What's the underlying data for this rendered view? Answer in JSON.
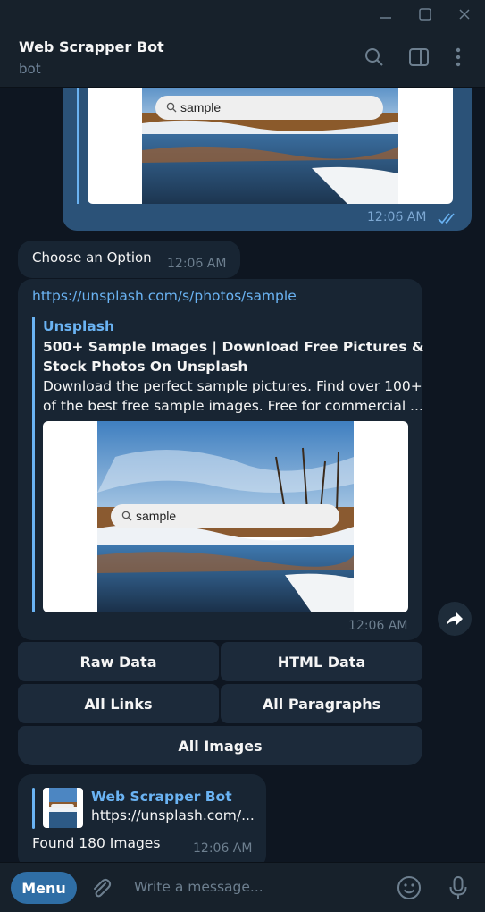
{
  "header": {
    "title": "Web Scrapper Bot",
    "subtitle": "bot"
  },
  "outgoing": {
    "search_text": "sample",
    "time": "12:06 AM"
  },
  "choose": {
    "text": "Choose an Option",
    "time": "12:06 AM"
  },
  "link_message": {
    "url": "https://unsplash.com/s/photos/sample",
    "site": "Unsplash",
    "title_line1": "500+ Sample Images | Download Free Pictures &",
    "title_line2": "Stock Photos On Unsplash",
    "desc_line1": "Download the perfect sample pictures. Find over 100+",
    "desc_line2": "of the best free sample images. Free for commercial ...",
    "search_text": "sample",
    "time": "12:06 AM"
  },
  "keyboard": {
    "raw_data": "Raw Data",
    "html_data": "HTML Data",
    "all_links": "All Links",
    "all_paragraphs": "All Paragraphs",
    "all_images": "All Images"
  },
  "reply_message": {
    "reply_name": "Web Scrapper Bot",
    "reply_text": "https://unsplash.com/...",
    "text": "Found 180 Images",
    "time": "12:06 AM"
  },
  "input": {
    "menu_label": "Menu",
    "placeholder": "Write a message..."
  },
  "icons": [
    "minimize-icon",
    "maximize-icon",
    "close-icon",
    "search-icon",
    "sidebar-toggle-icon",
    "more-vertical-icon",
    "double-check-icon",
    "share-icon",
    "paperclip-icon",
    "emoji-icon",
    "microphone-icon"
  ],
  "colors": {
    "background": "#0e1621",
    "panel": "#17212b",
    "incoming": "#182533",
    "outgoing": "#2b5278",
    "accent": "#6ab3f3",
    "menu": "#2f6ea5"
  }
}
